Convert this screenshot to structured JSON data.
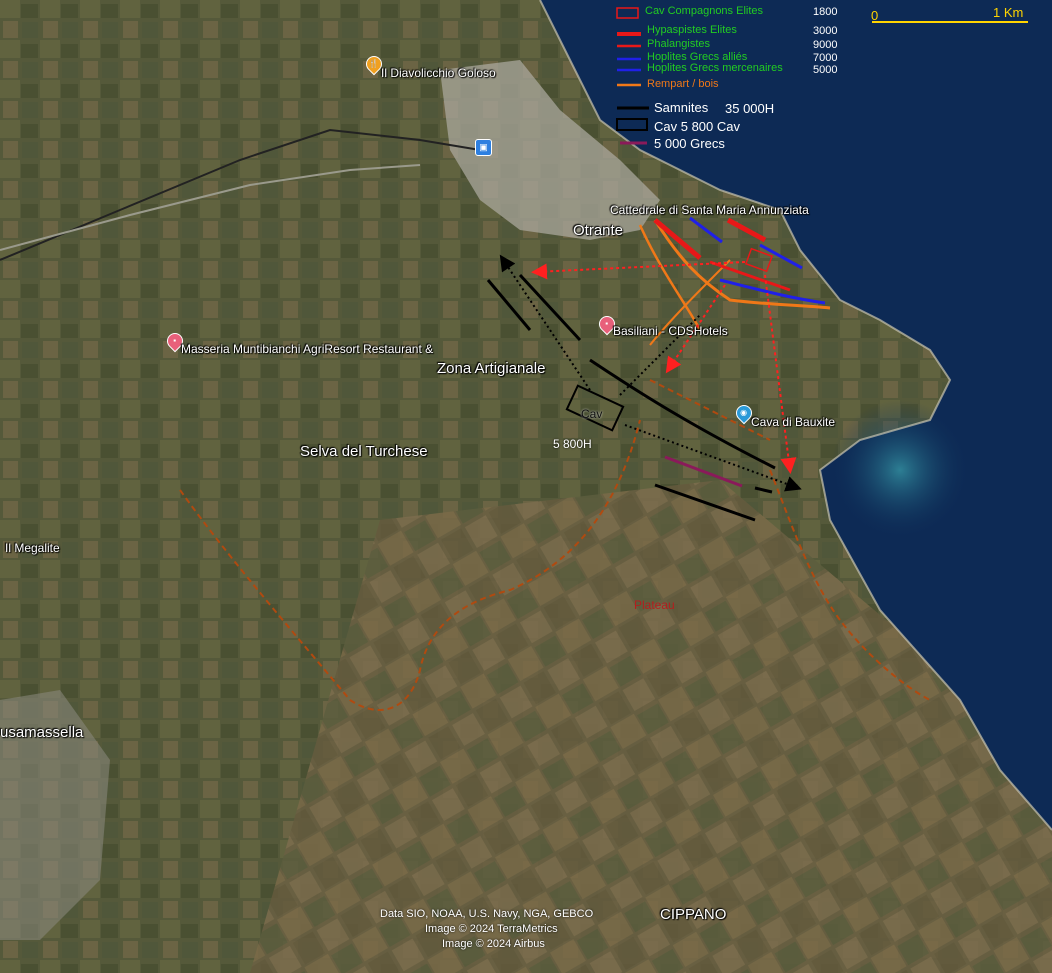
{
  "legend": [
    {
      "label": "Cav Compagnons Elites",
      "value": "1800",
      "color": "#22cc22",
      "symbol": "box-red"
    },
    {
      "label": "Hypaspistes Elites",
      "value": "3000",
      "color": "#22cc22",
      "symbol": "thick-red"
    },
    {
      "label": "Phalangistes",
      "value": "9000",
      "color": "#22cc22",
      "symbol": "red"
    },
    {
      "label": "Hoplites Grecs alliés",
      "value": "7000",
      "color": "#22cc22",
      "symbol": "blue"
    },
    {
      "label": "Hoplites Grecs mercenaires",
      "value": "5000",
      "color": "#22cc22",
      "symbol": "blue"
    },
    {
      "label": "Rempart / bois",
      "value": "",
      "color": "#f07818",
      "symbol": "orange"
    }
  ],
  "legend2": [
    {
      "label": "Samnites",
      "value": "35 000H",
      "symbol": "black-line"
    },
    {
      "label": "Cav 5 800 Cav",
      "symbol": "black-box"
    },
    {
      "label": "5 000 Grecs",
      "symbol": "purple-line"
    }
  ],
  "scale": {
    "zero": "0",
    "end": "1 Km",
    "color": "#ffd400"
  },
  "places": {
    "diavolicchio": "Il Diavolicchio Goloso",
    "cattedrale": "Cattedrale di Santa Maria Annunziata",
    "otrante": "Otrante",
    "basiliani": "Basiliani - CDSHotels",
    "masseria": "Masseria Muntibianchi AgriResort Restaurant &",
    "zona": "Zona Artigianale",
    "cava": "Cava di Bauxite",
    "selva": "Selva del Turchese",
    "megalite": "Il Megalite",
    "usamassella": "usamassella",
    "cippano": "CIPPANO",
    "plateau": "Plateau"
  },
  "annotations": {
    "cav": "Cav",
    "troops": "5 800H"
  },
  "credits": {
    "line1": "Data SIO, NOAA, U.S. Navy, NGA, GEBCO",
    "line2": "Image © 2024 TerraMetrics",
    "line3": "Image © 2024 Airbus"
  },
  "colors": {
    "sea": "#0d2a55",
    "land": "#5a5e3a",
    "samnites": "#000000",
    "phalanx": "#e81818",
    "hoplites": "#2020e8",
    "rampart": "#f07818",
    "greeks": "#8a1a5a",
    "advance": "#ff2020"
  }
}
